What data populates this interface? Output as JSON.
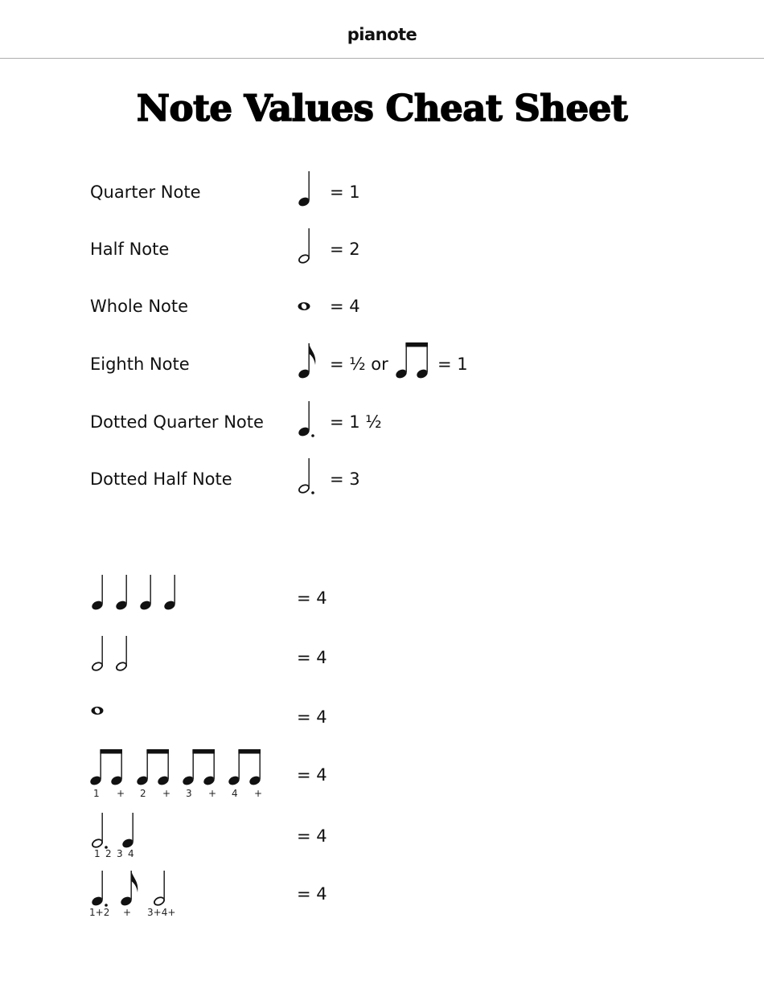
{
  "header": {
    "logo": "pianote"
  },
  "title": "Note Values Cheat Sheet",
  "note_values": [
    {
      "label": "Quarter Note",
      "icon": "quarter-note-icon",
      "value": "= 1"
    },
    {
      "label": "Half Note",
      "icon": "half-note-icon",
      "value": "= 2"
    },
    {
      "label": "Whole Note",
      "icon": "whole-note-icon",
      "value": "= 4"
    },
    {
      "label": "Eighth Note",
      "icon": "eighth-note-icon",
      "value": "= ½ or",
      "alt_icon": "beamed-eighth-notes-icon",
      "alt_value": "= 1"
    },
    {
      "label": "Dotted Quarter Note",
      "icon": "dotted-quarter-note-icon",
      "value": "= 1 ½"
    },
    {
      "label": "Dotted Half Note",
      "icon": "dotted-half-note-icon",
      "value": "= 3"
    }
  ],
  "combinations": [
    {
      "notes": [
        "quarter",
        "quarter",
        "quarter",
        "quarter"
      ],
      "counts": [],
      "value": "= 4"
    },
    {
      "notes": [
        "half",
        "half"
      ],
      "counts": [],
      "value": "= 4"
    },
    {
      "notes": [
        "whole"
      ],
      "counts": [],
      "value": "= 4"
    },
    {
      "notes": [
        "beamed-eighths",
        "beamed-eighths",
        "beamed-eighths",
        "beamed-eighths"
      ],
      "counts": [
        "1",
        "+",
        "2",
        "+",
        "3",
        "+",
        "4",
        "+"
      ],
      "value": "= 4"
    },
    {
      "notes": [
        "dotted-half",
        "quarter"
      ],
      "counts": [
        "1",
        "2",
        "3",
        "4"
      ],
      "value": "= 4"
    },
    {
      "notes": [
        "dotted-quarter",
        "eighth",
        "half"
      ],
      "counts": [
        "1+2",
        "+",
        "3+4+"
      ],
      "value": "= 4"
    }
  ]
}
